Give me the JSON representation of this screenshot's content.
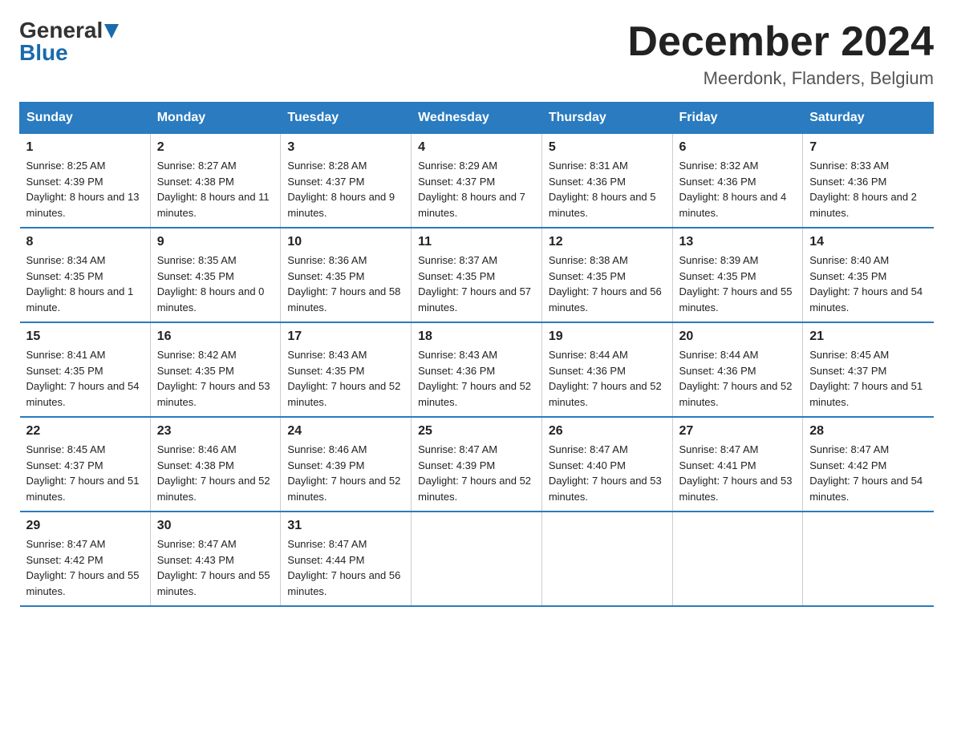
{
  "header": {
    "logo_general": "General",
    "logo_blue": "Blue",
    "month_title": "December 2024",
    "location": "Meerdonk, Flanders, Belgium"
  },
  "days_of_week": [
    "Sunday",
    "Monday",
    "Tuesday",
    "Wednesday",
    "Thursday",
    "Friday",
    "Saturday"
  ],
  "weeks": [
    [
      {
        "num": "1",
        "sunrise": "8:25 AM",
        "sunset": "4:39 PM",
        "daylight": "8 hours and 13 minutes."
      },
      {
        "num": "2",
        "sunrise": "8:27 AM",
        "sunset": "4:38 PM",
        "daylight": "8 hours and 11 minutes."
      },
      {
        "num": "3",
        "sunrise": "8:28 AM",
        "sunset": "4:37 PM",
        "daylight": "8 hours and 9 minutes."
      },
      {
        "num": "4",
        "sunrise": "8:29 AM",
        "sunset": "4:37 PM",
        "daylight": "8 hours and 7 minutes."
      },
      {
        "num": "5",
        "sunrise": "8:31 AM",
        "sunset": "4:36 PM",
        "daylight": "8 hours and 5 minutes."
      },
      {
        "num": "6",
        "sunrise": "8:32 AM",
        "sunset": "4:36 PM",
        "daylight": "8 hours and 4 minutes."
      },
      {
        "num": "7",
        "sunrise": "8:33 AM",
        "sunset": "4:36 PM",
        "daylight": "8 hours and 2 minutes."
      }
    ],
    [
      {
        "num": "8",
        "sunrise": "8:34 AM",
        "sunset": "4:35 PM",
        "daylight": "8 hours and 1 minute."
      },
      {
        "num": "9",
        "sunrise": "8:35 AM",
        "sunset": "4:35 PM",
        "daylight": "8 hours and 0 minutes."
      },
      {
        "num": "10",
        "sunrise": "8:36 AM",
        "sunset": "4:35 PM",
        "daylight": "7 hours and 58 minutes."
      },
      {
        "num": "11",
        "sunrise": "8:37 AM",
        "sunset": "4:35 PM",
        "daylight": "7 hours and 57 minutes."
      },
      {
        "num": "12",
        "sunrise": "8:38 AM",
        "sunset": "4:35 PM",
        "daylight": "7 hours and 56 minutes."
      },
      {
        "num": "13",
        "sunrise": "8:39 AM",
        "sunset": "4:35 PM",
        "daylight": "7 hours and 55 minutes."
      },
      {
        "num": "14",
        "sunrise": "8:40 AM",
        "sunset": "4:35 PM",
        "daylight": "7 hours and 54 minutes."
      }
    ],
    [
      {
        "num": "15",
        "sunrise": "8:41 AM",
        "sunset": "4:35 PM",
        "daylight": "7 hours and 54 minutes."
      },
      {
        "num": "16",
        "sunrise": "8:42 AM",
        "sunset": "4:35 PM",
        "daylight": "7 hours and 53 minutes."
      },
      {
        "num": "17",
        "sunrise": "8:43 AM",
        "sunset": "4:35 PM",
        "daylight": "7 hours and 52 minutes."
      },
      {
        "num": "18",
        "sunrise": "8:43 AM",
        "sunset": "4:36 PM",
        "daylight": "7 hours and 52 minutes."
      },
      {
        "num": "19",
        "sunrise": "8:44 AM",
        "sunset": "4:36 PM",
        "daylight": "7 hours and 52 minutes."
      },
      {
        "num": "20",
        "sunrise": "8:44 AM",
        "sunset": "4:36 PM",
        "daylight": "7 hours and 52 minutes."
      },
      {
        "num": "21",
        "sunrise": "8:45 AM",
        "sunset": "4:37 PM",
        "daylight": "7 hours and 51 minutes."
      }
    ],
    [
      {
        "num": "22",
        "sunrise": "8:45 AM",
        "sunset": "4:37 PM",
        "daylight": "7 hours and 51 minutes."
      },
      {
        "num": "23",
        "sunrise": "8:46 AM",
        "sunset": "4:38 PM",
        "daylight": "7 hours and 52 minutes."
      },
      {
        "num": "24",
        "sunrise": "8:46 AM",
        "sunset": "4:39 PM",
        "daylight": "7 hours and 52 minutes."
      },
      {
        "num": "25",
        "sunrise": "8:47 AM",
        "sunset": "4:39 PM",
        "daylight": "7 hours and 52 minutes."
      },
      {
        "num": "26",
        "sunrise": "8:47 AM",
        "sunset": "4:40 PM",
        "daylight": "7 hours and 53 minutes."
      },
      {
        "num": "27",
        "sunrise": "8:47 AM",
        "sunset": "4:41 PM",
        "daylight": "7 hours and 53 minutes."
      },
      {
        "num": "28",
        "sunrise": "8:47 AM",
        "sunset": "4:42 PM",
        "daylight": "7 hours and 54 minutes."
      }
    ],
    [
      {
        "num": "29",
        "sunrise": "8:47 AM",
        "sunset": "4:42 PM",
        "daylight": "7 hours and 55 minutes."
      },
      {
        "num": "30",
        "sunrise": "8:47 AM",
        "sunset": "4:43 PM",
        "daylight": "7 hours and 55 minutes."
      },
      {
        "num": "31",
        "sunrise": "8:47 AM",
        "sunset": "4:44 PM",
        "daylight": "7 hours and 56 minutes."
      },
      null,
      null,
      null,
      null
    ]
  ]
}
